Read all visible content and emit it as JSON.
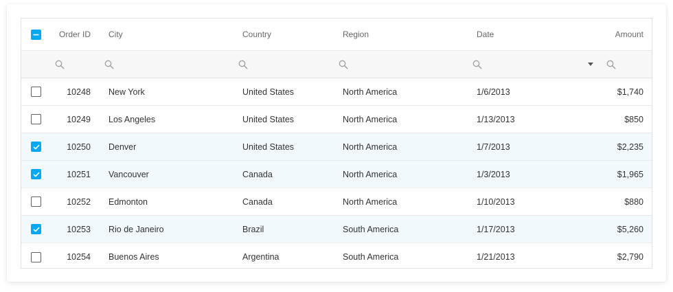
{
  "columns": {
    "order_id": "Order ID",
    "city": "City",
    "country": "Country",
    "region": "Region",
    "date": "Date",
    "amount": "Amount"
  },
  "select_all_state": "indeterminate",
  "accent_color": "#03a9f4",
  "filter_icons": [
    "search-icon",
    "search-icon",
    "search-icon",
    "search-icon",
    "search-icon",
    "search-icon"
  ],
  "rows": [
    {
      "selected": false,
      "order_id": "10248",
      "city": "New York",
      "country": "United States",
      "region": "North America",
      "date": "1/6/2013",
      "amount": "$1,740"
    },
    {
      "selected": false,
      "order_id": "10249",
      "city": "Los Angeles",
      "country": "United States",
      "region": "North America",
      "date": "1/13/2013",
      "amount": "$850"
    },
    {
      "selected": true,
      "order_id": "10250",
      "city": "Denver",
      "country": "United States",
      "region": "North America",
      "date": "1/7/2013",
      "amount": "$2,235"
    },
    {
      "selected": true,
      "order_id": "10251",
      "city": "Vancouver",
      "country": "Canada",
      "region": "North America",
      "date": "1/3/2013",
      "amount": "$1,965"
    },
    {
      "selected": false,
      "order_id": "10252",
      "city": "Edmonton",
      "country": "Canada",
      "region": "North America",
      "date": "1/10/2013",
      "amount": "$880"
    },
    {
      "selected": true,
      "order_id": "10253",
      "city": "Rio de Janeiro",
      "country": "Brazil",
      "region": "South America",
      "date": "1/17/2013",
      "amount": "$5,260"
    },
    {
      "selected": false,
      "order_id": "10254",
      "city": "Buenos Aires",
      "country": "Argentina",
      "region": "South America",
      "date": "1/21/2013",
      "amount": "$2,790"
    }
  ]
}
